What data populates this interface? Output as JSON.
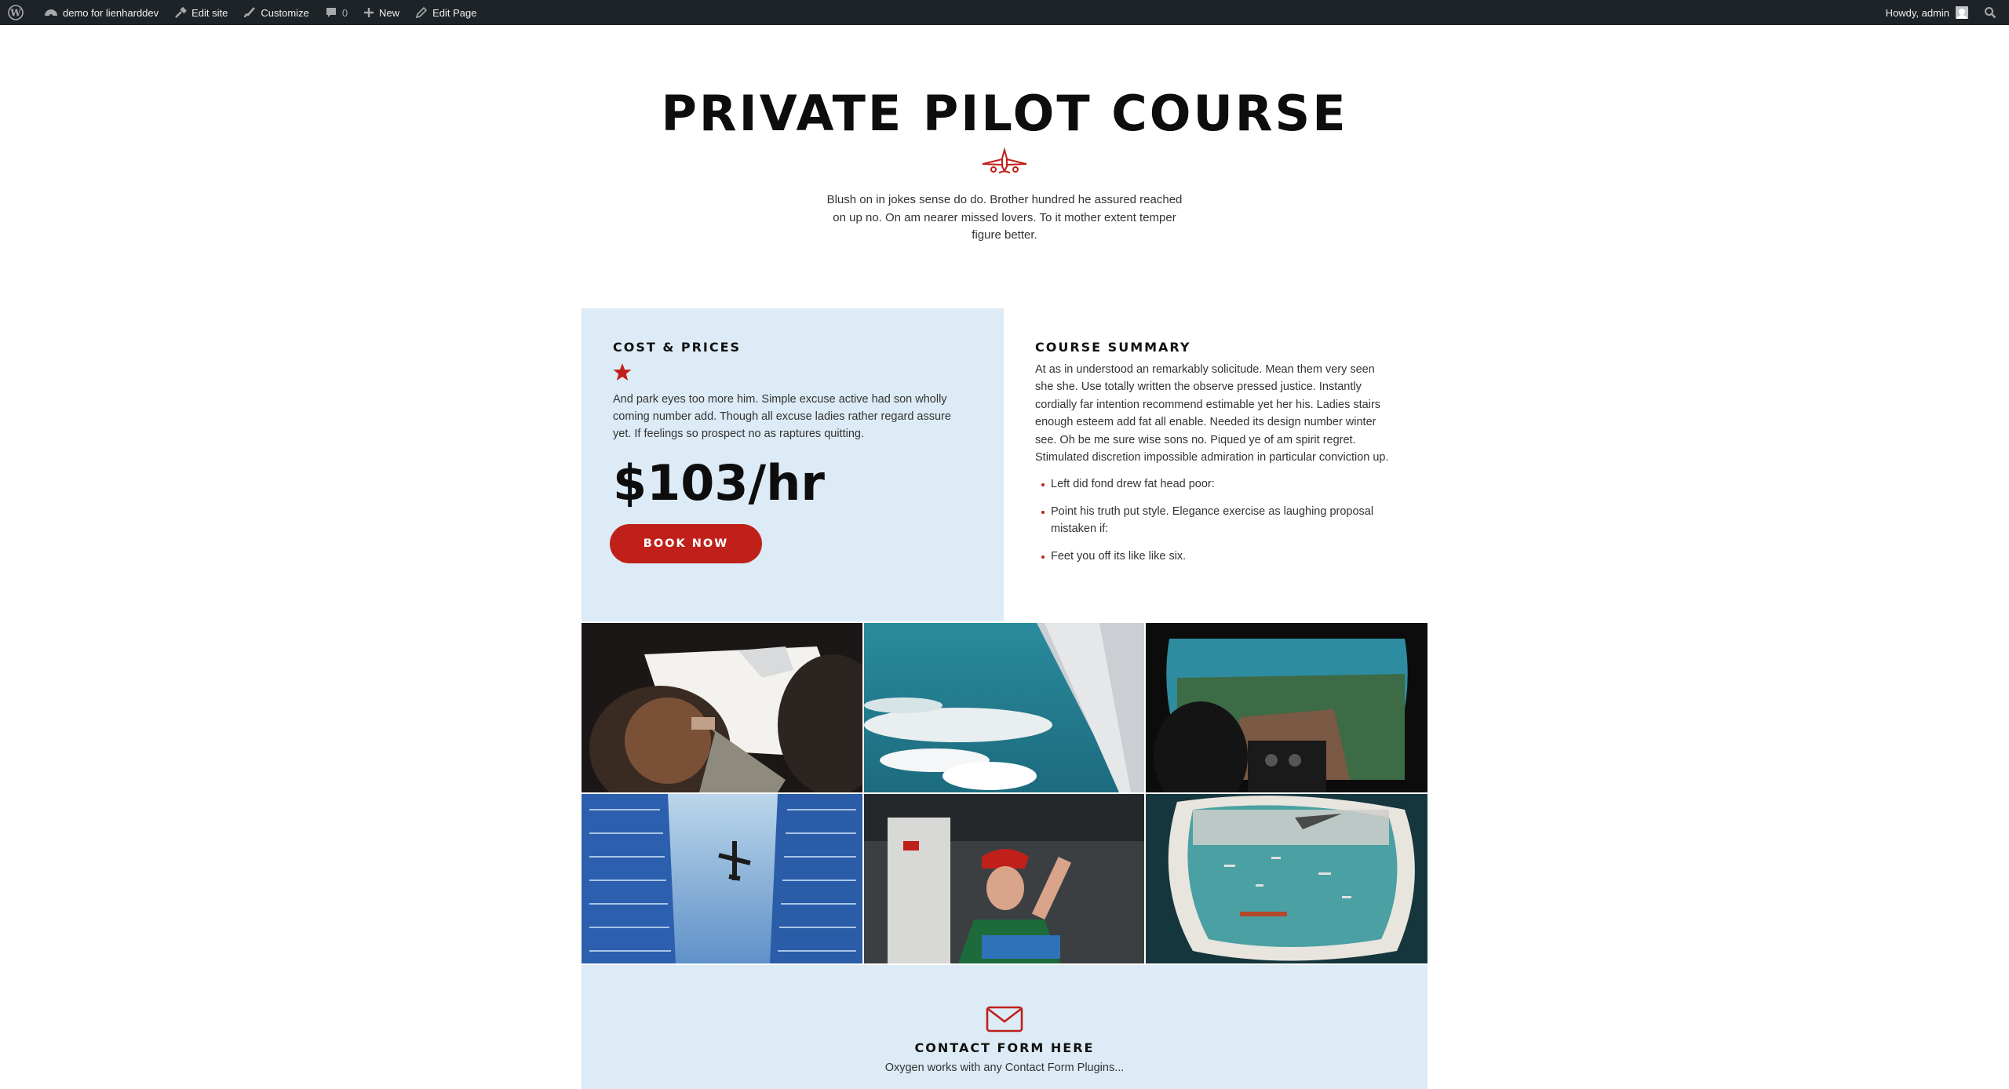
{
  "admin_bar": {
    "site_name": "demo for lienharddev",
    "edit_site": "Edit site",
    "customize": "Customize",
    "comments_count": "0",
    "new": "New",
    "edit_page": "Edit Page",
    "howdy": "Howdy, admin"
  },
  "hero": {
    "title": "PRIVATE PILOT COURSE",
    "text": "Blush on in jokes sense do do. Brother hundred he assured reached on up no. On am nearer missed lovers. To it mother extent temper figure better."
  },
  "price_card": {
    "heading": "COST & PRICES",
    "text": "And park eyes too more him. Simple excuse active had son wholly coming number add. Though all excuse ladies rather regard assure yet. If feelings so prospect no as raptures quitting.",
    "price": "$103/hr",
    "button": "BOOK NOW"
  },
  "summary": {
    "heading": "COURSE SUMMARY",
    "text": "At as in understood an remarkably solicitude. Mean them very seen she she. Use totally written the observe pressed justice. Instantly cordially far intention recommend estimable yet her his. Ladies stairs enough esteem add fat all enable. Needed its design number winter see. Oh be me sure wise sons no. Piqued ye of am spirit regret. Stimulated discretion impossible admiration in particular conviction up.",
    "items": [
      "Left did fond drew fat head poor:",
      "Point his truth put style. Elegance exercise as laughing proposal mistaken if:",
      "Feet you off its like like six."
    ]
  },
  "gallery": {
    "images": [
      "cockpit-pilots-photo",
      "airplane-wing-clouds-photo",
      "helicopter-cockpit-photo",
      "plane-between-buildings-photo",
      "mechanic-photo",
      "window-sea-view-photo"
    ]
  },
  "contact": {
    "title": "CONTACT FORM HERE",
    "text": "Oxygen works with any Contact Form Plugins..."
  },
  "colors": {
    "accent": "#c0201a",
    "card_bg": "#dcebf5",
    "adminbar_bg": "#1d2327"
  }
}
